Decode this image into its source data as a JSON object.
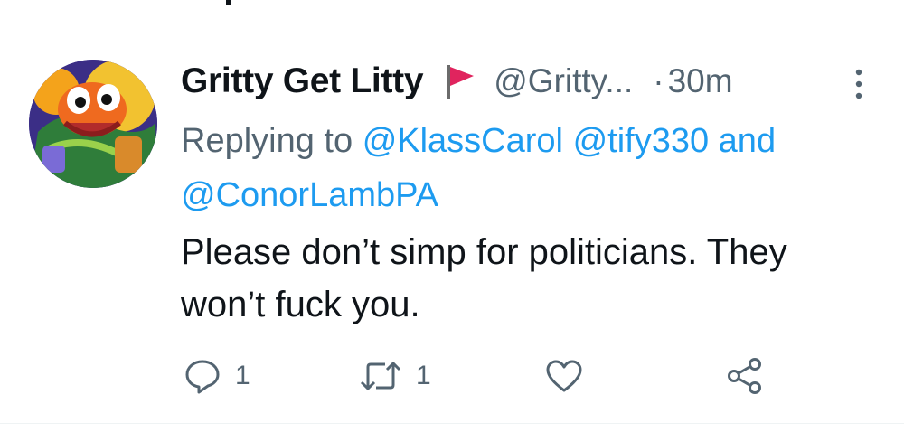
{
  "tweet": {
    "display_name": "Gritty Get Litty",
    "handle": "@Gritty...",
    "separator": "·",
    "time": "30m",
    "reply_prefix": "Replying to",
    "mention_1": "@KlassCarol",
    "mention_2": "@tify330",
    "reply_and": "and",
    "mention_3": "@ConorLambPA",
    "text": "Please don’t simp for politicians. They won’t fuck you."
  },
  "actions": {
    "reply_count": "1",
    "retweet_count": "1"
  },
  "icons": {
    "avatar": "gritty-avatar",
    "flag": "red-flag-emoji-icon",
    "more": "more-vertical-icon",
    "reply": "reply-icon",
    "retweet": "retweet-icon",
    "like": "heart-icon",
    "share": "share-icon"
  },
  "colors": {
    "text_primary": "#0f1419",
    "text_secondary": "#536471",
    "link": "#1d9bf0",
    "flag": "#e0245e"
  }
}
